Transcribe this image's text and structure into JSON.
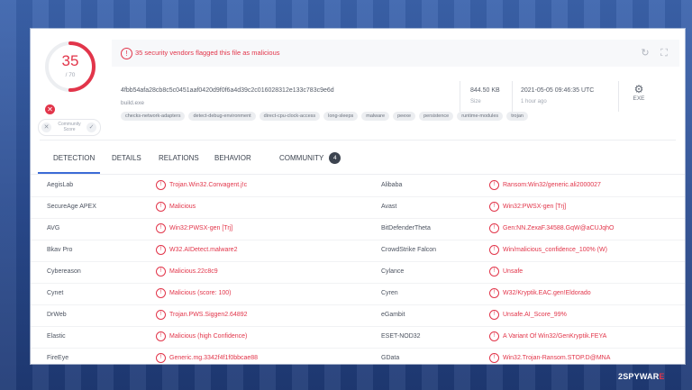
{
  "score": {
    "malicious": "35",
    "total": "/ 70"
  },
  "community": {
    "label": "Community Score"
  },
  "alert": {
    "text": "35 security vendors flagged this file as malicious"
  },
  "file": {
    "hash": "4fbb54afa28cb8c5c0451aaf0420d9f0f6a4d39c2c016028312e133c783c9e6d",
    "name": "build.exe",
    "size_value": "844.50 KB",
    "size_label": "Size",
    "date_value": "2021-05-05 09:46:35 UTC",
    "date_label": "1 hour ago",
    "type": "EXE",
    "tags": [
      "checks-network-adapters",
      "detect-debug-environment",
      "direct-cpu-clock-access",
      "long-sleeps",
      "malware",
      "peexe",
      "persistence",
      "runtime-modules",
      "trojan"
    ]
  },
  "tabs": [
    {
      "label": "DETECTION"
    },
    {
      "label": "DETAILS"
    },
    {
      "label": "RELATIONS"
    },
    {
      "label": "BEHAVIOR"
    },
    {
      "label": "COMMUNITY",
      "badge": "4"
    }
  ],
  "detections": [
    {
      "left_vendor": "AegisLab",
      "left_result": "Trojan.Win32.Convagent.j!c",
      "right_vendor": "Alibaba",
      "right_result": "Ransom:Win32/generic.ali2000027"
    },
    {
      "left_vendor": "SecureAge APEX",
      "left_result": "Malicious",
      "right_vendor": "Avast",
      "right_result": "Win32:PWSX-gen [Trj]"
    },
    {
      "left_vendor": "AVG",
      "left_result": "Win32:PWSX-gen [Trj]",
      "right_vendor": "BitDefenderTheta",
      "right_result": "Gen:NN.ZexaF.34588.GqW@aCUJqhO"
    },
    {
      "left_vendor": "Bkav Pro",
      "left_result": "W32.AIDetect.malware2",
      "right_vendor": "CrowdStrike Falcon",
      "right_result": "Win/malicious_confidence_100% (W)"
    },
    {
      "left_vendor": "Cybereason",
      "left_result": "Malicious.22c8c9",
      "right_vendor": "Cylance",
      "right_result": "Unsafe"
    },
    {
      "left_vendor": "Cynet",
      "left_result": "Malicious (score: 100)",
      "right_vendor": "Cyren",
      "right_result": "W32/Kryptik.EAC.gen!Eldorado"
    },
    {
      "left_vendor": "DrWeb",
      "left_result": "Trojan.PWS.Siggen2.64892",
      "right_vendor": "eGambit",
      "right_result": "Unsafe.AI_Score_99%"
    },
    {
      "left_vendor": "Elastic",
      "left_result": "Malicious (high Confidence)",
      "right_vendor": "ESET-NOD32",
      "right_result": "A Variant Of Win32/GenKryptik.FEYA"
    },
    {
      "left_vendor": "FireEye",
      "left_result": "Generic.mg.3342f4f1f0bbcae88",
      "right_vendor": "GData",
      "right_result": "Win32.Trojan-Ransom.STOP.D@MNA"
    }
  ],
  "watermark": {
    "part1": "2SPYWAR",
    "part2": "E"
  },
  "colors": {
    "accent": "#e2354a",
    "tab_active": "#3c6bd6",
    "frame": "#2d4f93"
  }
}
